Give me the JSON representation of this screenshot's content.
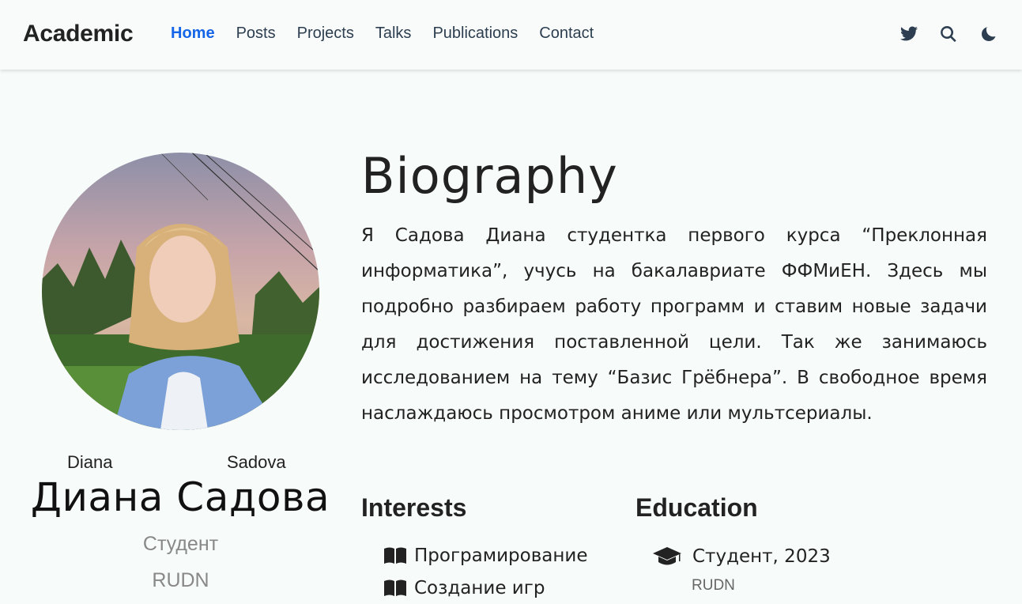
{
  "navbar": {
    "brand": "Academic",
    "links": [
      {
        "label": "Home",
        "active": true
      },
      {
        "label": "Posts",
        "active": false
      },
      {
        "label": "Projects",
        "active": false
      },
      {
        "label": "Talks",
        "active": false
      },
      {
        "label": "Publications",
        "active": false
      },
      {
        "label": "Contact",
        "active": false
      }
    ],
    "icons": [
      "twitter-icon",
      "search-icon",
      "moon-icon"
    ],
    "accent_color": "#1565e8"
  },
  "profile": {
    "first_name": "Diana",
    "last_name": "Sadova",
    "full_name": "Диана Садова",
    "role": "Студент",
    "organization": "RUDN"
  },
  "biography": {
    "title": "Biography",
    "text": "Я Садова Диана студентка первого курса “Преклонная информатика”, учусь на бакалавриате ФФМиЕН. Здесь мы подробно разбираем работу программ и ставим новые задачи для достижения поставленной цели. Так же занимаюсь исследованием на тему “Базис Грёбнера”. В свободное время наслаждаюсь просмотром аниме или мультсериалы."
  },
  "interests": {
    "title": "Interests",
    "items": [
      "Програмирование",
      "Создание игр"
    ]
  },
  "education": {
    "title": "Education",
    "items": [
      {
        "degree": "Студент, 2023",
        "institution": "RUDN"
      }
    ]
  }
}
